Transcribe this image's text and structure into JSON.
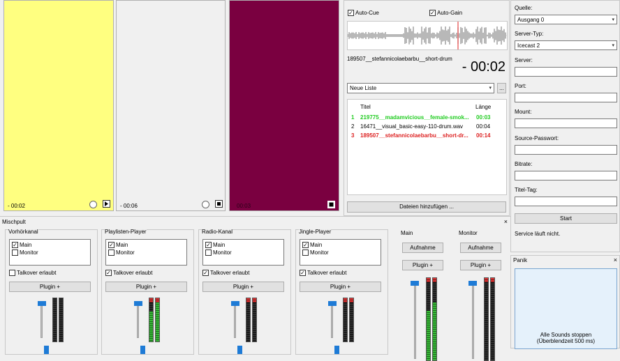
{
  "players": [
    {
      "color": "#ffff80",
      "time": "- 00:02",
      "border": "#b0b0b0",
      "text": "#000"
    },
    {
      "color": "#f0f0f0",
      "time": "- 00:06",
      "border": "#b0b0b0",
      "text": "#000"
    },
    {
      "color": "#7a0040",
      "time": "00:03",
      "border": "#b0b0b0",
      "text": "#000"
    }
  ],
  "deck": {
    "auto_cue": "Auto-Cue",
    "auto_gain": "Auto-Gain",
    "track_name": "189507__stefannicolaebarbu__short-drum",
    "remaining": "- 00:02",
    "playlist_select": "Neue Liste",
    "more_button": "...",
    "col_title": "Titel",
    "col_length": "Länge",
    "rows": [
      {
        "num": "1",
        "title": "219775__madamvicious__female-smok...",
        "len": "00:03",
        "color": "#22cc22"
      },
      {
        "num": "2",
        "title": "16471__visual_basic-easy-110-drum.wav",
        "len": "00:04",
        "color": "#000000"
      },
      {
        "num": "3",
        "title": "189507__stefannicolaebarbu__short-dr...",
        "len": "00:14",
        "color": "#dd2222"
      }
    ],
    "add_files": "Dateien hinzufügen ..."
  },
  "stream": {
    "source_label": "Quelle:",
    "source_value": "Ausgang 0",
    "server_type_label": "Server-Typ:",
    "server_type_value": "Icecast 2",
    "server_label": "Server:",
    "port_label": "Port:",
    "mount_label": "Mount:",
    "password_label": "Source-Passwort:",
    "bitrate_label": "Bitrate:",
    "title_tag_label": "Titel-Tag:",
    "start_button": "Start",
    "status": "Service läuft nicht."
  },
  "panic": {
    "title": "Panik",
    "close": "×",
    "button_line1": "Alle Sounds stoppen",
    "button_line2": "(Überblendzeit 500 ms)"
  },
  "mixer": {
    "title": "Mischpult",
    "close": "×",
    "channels": [
      {
        "name": "Vorhörkanal",
        "main": "Main",
        "monitor": "Monitor",
        "main_checked": true,
        "monitor_checked": false,
        "talkover": "Talkover erlaubt",
        "talkover_checked": false,
        "plugin": "Plugin +",
        "level_l": 0,
        "level_r": 0,
        "clip": false
      },
      {
        "name": "Playlisten-Player",
        "main": "Main",
        "monitor": "Monitor",
        "main_checked": true,
        "monitor_checked": false,
        "talkover": "Talkover erlaubt",
        "talkover_checked": true,
        "plugin": "Plugin +",
        "level_l": 0.7,
        "level_r": 0.95,
        "clip": true
      },
      {
        "name": "Radio-Kanal",
        "main": "Main",
        "monitor": "Monitor",
        "main_checked": true,
        "monitor_checked": false,
        "talkover": "Talkover erlaubt",
        "talkover_checked": true,
        "plugin": "Plugin +",
        "level_l": 0,
        "level_r": 0,
        "clip": true
      },
      {
        "name": "Jingle-Player",
        "main": "Main",
        "monitor": "Monitor",
        "main_checked": true,
        "monitor_checked": false,
        "talkover": "Talkover erlaubt",
        "talkover_checked": true,
        "plugin": "Plugin +",
        "level_l": 0,
        "level_r": 0,
        "clip": true
      }
    ],
    "outputs": [
      {
        "name": "Main",
        "record": "Aufnahme",
        "plugin": "Plugin +",
        "level_l": 0.6,
        "level_r": 0.7
      },
      {
        "name": "Monitor",
        "record": "Aufnahme",
        "plugin": "Plugin +",
        "level_l": 0,
        "level_r": 0
      }
    ]
  }
}
